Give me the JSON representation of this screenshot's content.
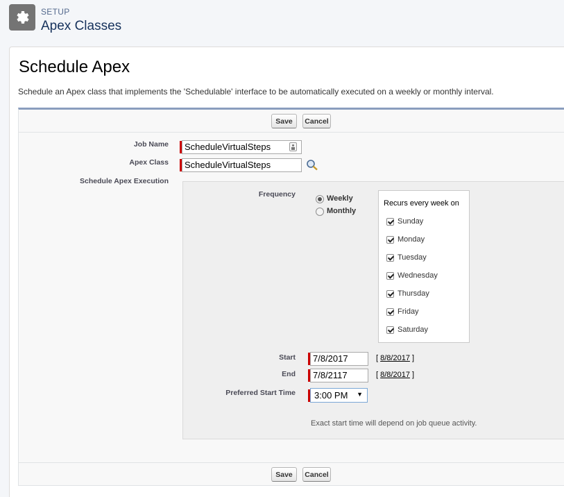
{
  "header": {
    "section": "SETUP",
    "title": "Apex Classes",
    "icon": "gear-icon"
  },
  "page": {
    "title": "Schedule Apex",
    "description": "Schedule an Apex class that implements the 'Schedulable' interface to be automatically executed on a weekly or monthly interval."
  },
  "buttons": {
    "save": "Save",
    "cancel": "Cancel"
  },
  "form": {
    "job_name_label": "Job Name",
    "job_name_value": "ScheduleVirtualSteps",
    "apex_class_label": "Apex Class",
    "apex_class_value": "ScheduleVirtualSteps",
    "schedule_label": "Schedule Apex Execution",
    "frequency_label": "Frequency",
    "frequency_options": [
      "Weekly",
      "Monthly"
    ],
    "frequency_selected": "Weekly",
    "recurs_label": "Recurs every week on",
    "days": [
      "Sunday",
      "Monday",
      "Tuesday",
      "Wednesday",
      "Thursday",
      "Friday",
      "Saturday"
    ],
    "start_label": "Start",
    "start_value": "7/8/2017",
    "start_link_open": "[",
    "start_link": "8/8/2017",
    "start_link_close": "]",
    "end_label": "End",
    "end_value": "7/8/2117",
    "end_link_open": "[",
    "end_link": "8/8/2017",
    "end_link_close": "]",
    "time_label": "Preferred Start Time",
    "time_value": "3:00 PM",
    "note": "Exact start time will depend on job queue activity."
  }
}
